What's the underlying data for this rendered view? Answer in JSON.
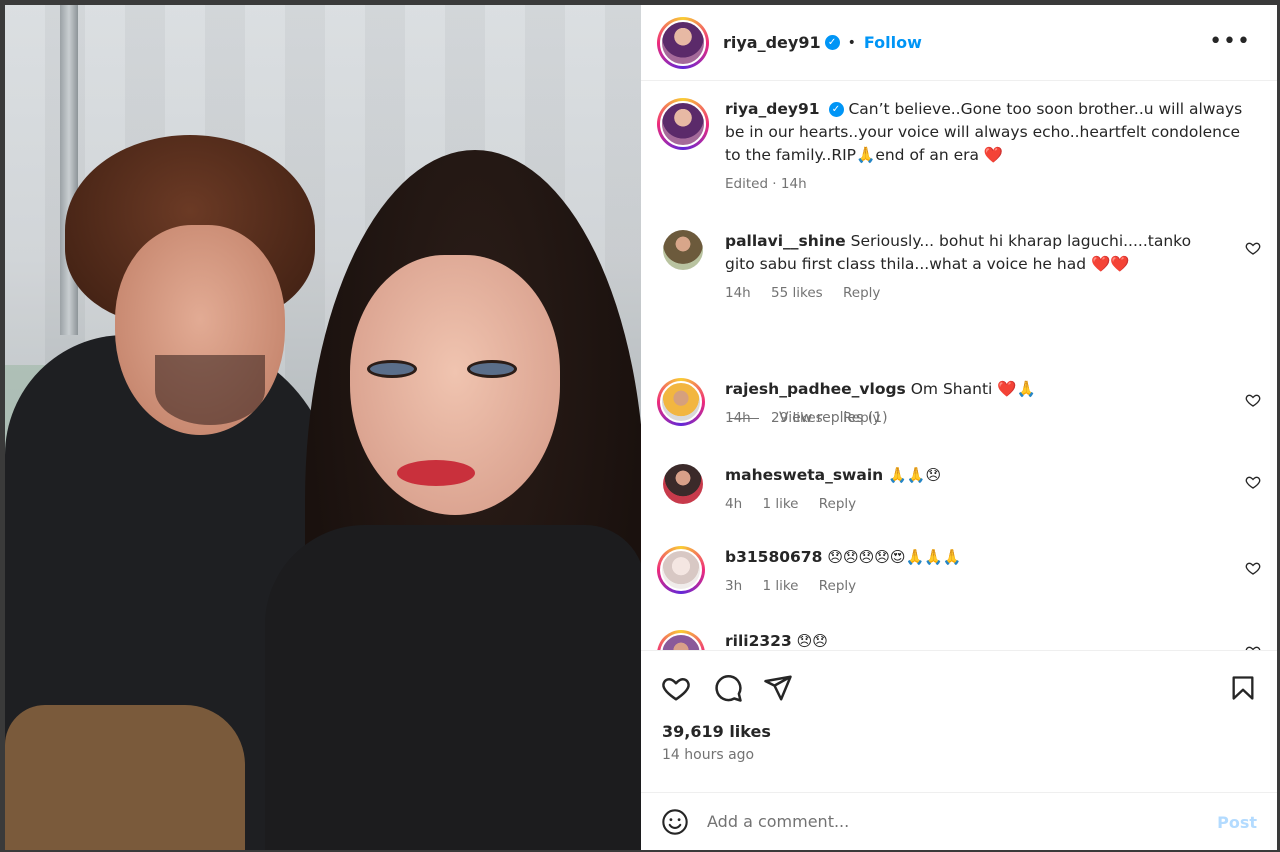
{
  "post": {
    "username": "riya_dey91",
    "follow_label": "Follow",
    "dot": "•",
    "more_label": "•••",
    "caption": {
      "username": "riya_dey91",
      "text": "Can’t believe..Gone too soon brother..u will always be in our hearts..your voice will always echo..heartfelt condolence to the family..RIP🙏end of an era ❤️",
      "edited": "Edited · 14h"
    }
  },
  "comments": [
    {
      "username": "pallavi__shine",
      "text": "Seriously... bohut hi kharap laguchi.....tanko gito sabu first class thila...what a voice he had ❤️❤️",
      "time": "14h",
      "likes": "55 likes",
      "reply": "Reply",
      "view_replies": "View replies (1)"
    },
    {
      "username": "rajesh_padhee_vlogs",
      "text": "Om Shanti ❤️🙏",
      "time": "14h",
      "likes": "29 likes",
      "reply": "Reply"
    },
    {
      "username": "mahesweta_swain",
      "text": "🙏🙏😞",
      "time": "4h",
      "likes": "1 like",
      "reply": "Reply"
    },
    {
      "username": "b31580678",
      "text": "😞😞😞😞😍🙏🙏🙏",
      "time": "3h",
      "likes": "1 like",
      "reply": "Reply"
    },
    {
      "username": "rili2323",
      "text": "😞😞"
    }
  ],
  "footer": {
    "likes": "39,619 likes",
    "time_ago": "14 hours ago",
    "comment_placeholder": "Add a comment...",
    "post_label": "Post"
  },
  "colors": {
    "accent": "#0095f6",
    "muted": "#737373",
    "post_disabled": "#b3dbff"
  }
}
